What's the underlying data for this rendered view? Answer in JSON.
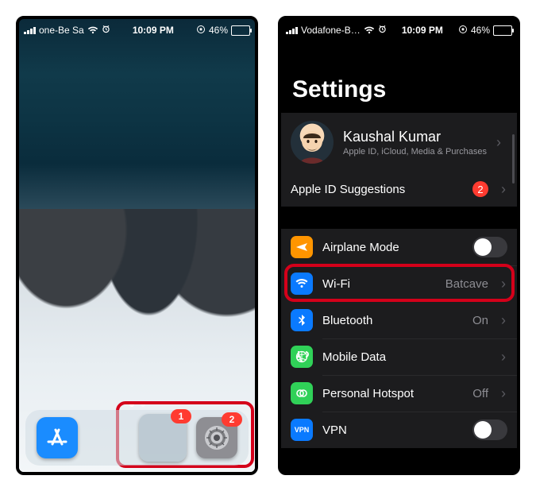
{
  "left": {
    "status": {
      "carrier": "one-Be Sa",
      "time": "10:09 PM",
      "battery_pct": "46%"
    },
    "dock": {
      "folder_badge": "1",
      "settings_badge": "2"
    }
  },
  "right": {
    "status": {
      "carrier": "Vodafone-B…",
      "time": "10:09 PM",
      "battery_pct": "46%"
    },
    "title": "Settings",
    "profile": {
      "name": "Kaushal Kumar",
      "sub": "Apple ID, iCloud, Media & Purchases"
    },
    "apple_id_suggestions": {
      "label": "Apple ID Suggestions",
      "count": "2"
    },
    "rows": {
      "airplane": "Airplane Mode",
      "wifi": {
        "label": "Wi-Fi",
        "value": "Batcave"
      },
      "bluetooth": {
        "label": "Bluetooth",
        "value": "On"
      },
      "mobile_data": "Mobile Data",
      "hotspot": {
        "label": "Personal Hotspot",
        "value": "Off"
      },
      "vpn": "VPN"
    },
    "colors": {
      "airplane": "#ff9500",
      "wifi": "#0a7aff",
      "bluetooth": "#0a7aff",
      "mobile_data": "#30d158",
      "hotspot": "#30d158",
      "vpn": "#0a7aff"
    }
  }
}
